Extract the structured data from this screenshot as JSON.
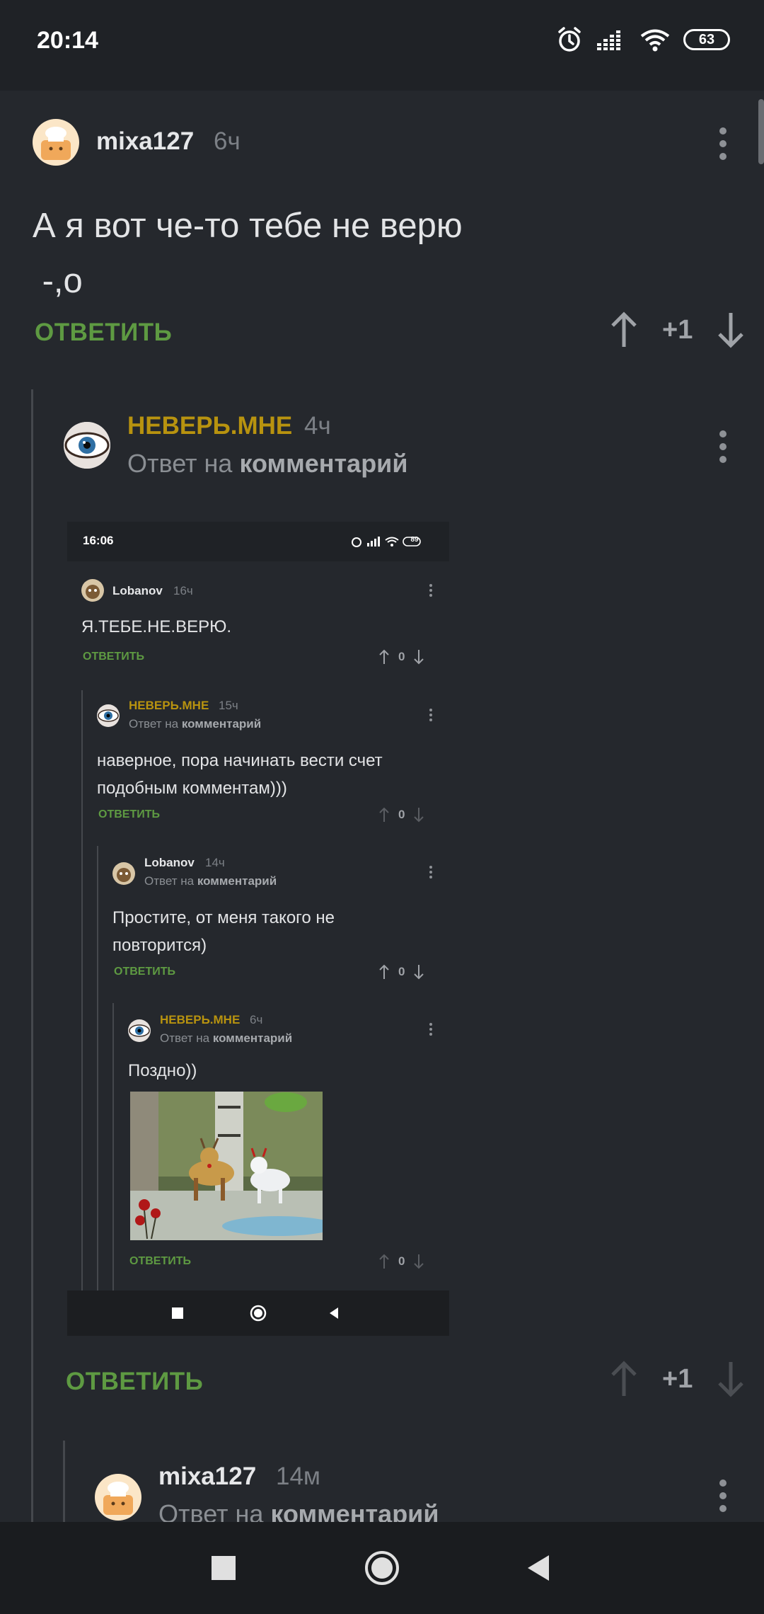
{
  "status_bar": {
    "time": "20:14",
    "battery": "63"
  },
  "comments": {
    "top": {
      "user": "mixa127",
      "time": "6ч",
      "text_line1": "А я вот че-то тебе не верю",
      "text_line2": " -,о",
      "reply_label": "ОТВЕТИТЬ",
      "score": "+1"
    },
    "reply1": {
      "user": "НЕВЕРЬ.МНЕ",
      "time": "4ч",
      "reply_prefix": "Ответ на",
      "reply_target": "комментарий",
      "reply_label": "ОТВЕТИТЬ",
      "score": "+1"
    },
    "reply2": {
      "user": "mixa127",
      "time": "14м",
      "reply_prefix": "Ответ на",
      "reply_target": "комментарий"
    }
  },
  "embedded_screenshot": {
    "status_time": "16:06",
    "battery": "89",
    "c1": {
      "user": "Lobanov",
      "time": "16ч",
      "text": "Я.ТЕБЕ.НЕ.ВЕРЮ.",
      "reply_label": "ОТВЕТИТЬ",
      "score": "0"
    },
    "c2": {
      "user": "НЕВЕРЬ.МНЕ",
      "time": "15ч",
      "reply_prefix": "Ответ на",
      "reply_target": "комментарий",
      "text_line1": "наверное, пора начинать вести счет",
      "text_line2": "подобным комментам)))",
      "reply_label": "ОТВЕТИТЬ",
      "score": "0"
    },
    "c3": {
      "user": "Lobanov",
      "time": "14ч",
      "reply_prefix": "Ответ на",
      "reply_target": "комментарий",
      "text_line1": "Простите, от меня такого не",
      "text_line2": "повторится)",
      "reply_label": "ОТВЕТИТЬ",
      "score": "0"
    },
    "c4": {
      "user": "НЕВЕРЬ.МНЕ",
      "time": "6ч",
      "reply_prefix": "Ответ на",
      "reply_target": "комментарий",
      "text": "Поздно))",
      "reply_label": "ОТВЕТИТЬ",
      "score": "0"
    }
  },
  "colors": {
    "background": "#25282d",
    "accent_green": "#5e9a42",
    "username_gold": "#b8930f",
    "username_white": "#e6e7e9"
  },
  "icons": [
    "alarm-icon",
    "signal-icon",
    "wifi-icon",
    "battery-icon",
    "more-vert-icon",
    "arrow-up-icon",
    "arrow-down-icon",
    "square-nav-icon",
    "circle-nav-icon",
    "back-nav-icon"
  ]
}
